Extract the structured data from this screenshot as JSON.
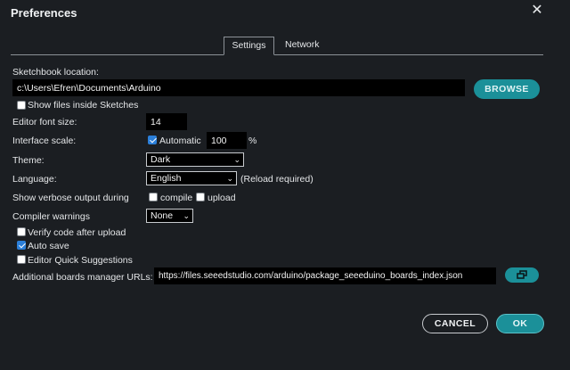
{
  "dialog": {
    "title": "Preferences",
    "close_glyph": "✕"
  },
  "tabs": [
    {
      "label": "Settings",
      "active": true
    },
    {
      "label": "Network",
      "active": false
    }
  ],
  "settings": {
    "sketchbook": {
      "label": "Sketchbook location:",
      "value": "c:\\Users\\Efren\\Documents\\Arduino",
      "browse_label": "BROWSE"
    },
    "show_files": {
      "label": "Show files inside Sketches",
      "checked": false
    },
    "font_size": {
      "label": "Editor font size:",
      "value": "14"
    },
    "interface_scale": {
      "label": "Interface scale:",
      "automatic_label": "Automatic",
      "automatic_checked": true,
      "value": "100",
      "unit": "%"
    },
    "theme": {
      "label": "Theme:",
      "value": "Dark"
    },
    "language": {
      "label": "Language:",
      "value": "English",
      "note": "(Reload required)"
    },
    "verbose": {
      "label": "Show verbose output during",
      "compile_label": "compile",
      "compile_checked": false,
      "upload_label": "upload",
      "upload_checked": false
    },
    "compiler_warnings": {
      "label": "Compiler warnings",
      "value": "None"
    },
    "verify": {
      "label": "Verify code after upload",
      "checked": false
    },
    "autosave": {
      "label": "Auto save",
      "checked": true
    },
    "quick_suggestions": {
      "label": "Editor Quick Suggestions",
      "checked": false
    },
    "boards_urls": {
      "label": "Additional boards manager URLs:",
      "value": "https://files.seeedstudio.com/arduino/package_seeeduino_boards_index.json",
      "button_icon": "open-window-icon"
    }
  },
  "footer": {
    "cancel_label": "CANCEL",
    "ok_label": "OK"
  },
  "colors": {
    "accent": "#1b9099",
    "background": "#1b1e22",
    "field": "#000000",
    "checkbox_checked": "#2b7fd9"
  }
}
